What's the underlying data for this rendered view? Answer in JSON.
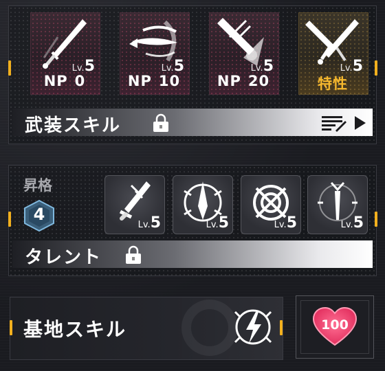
{
  "weapon_skills": {
    "cards": [
      {
        "level_prefix": "Lv.",
        "level": "5",
        "label": "NP",
        "value": "0",
        "icon": "sword-icon"
      },
      {
        "level_prefix": "Lv.",
        "level": "5",
        "label": "NP",
        "value": "10",
        "icon": "dagger-swirl-icon"
      },
      {
        "level_prefix": "Lv.",
        "level": "5",
        "label": "NP",
        "value": "20",
        "icon": "burst-sword-icon"
      },
      {
        "level_prefix": "Lv.",
        "level": "5",
        "label": "特性",
        "value": "",
        "icon": "crossed-blades-icon"
      }
    ],
    "header": "武装スキル",
    "header_icon": "lock-icon",
    "list_icon": "list-edit-icon",
    "next_icon": "play-arrow-icon"
  },
  "ascension": {
    "label": "昇格",
    "rank": "4",
    "talents": [
      {
        "level_prefix": "Lv.",
        "level": "5",
        "icon": "blade-up-icon"
      },
      {
        "level_prefix": "Lv.",
        "level": "5",
        "icon": "arrow-target-icon"
      },
      {
        "level_prefix": "Lv.",
        "level": "5",
        "icon": "crosshair-icon"
      },
      {
        "level_prefix": "Lv.",
        "level": "5",
        "icon": "figure-icon"
      }
    ],
    "header": "タレント",
    "header_icon": "lock-icon"
  },
  "base_skill": {
    "header": "基地スキル",
    "icon": "lightning-shield-icon",
    "heart_value": "100",
    "heart_color": "#ff3d6e"
  },
  "colors": {
    "accent": "#f2b01e",
    "trait": "#f6b82e"
  }
}
